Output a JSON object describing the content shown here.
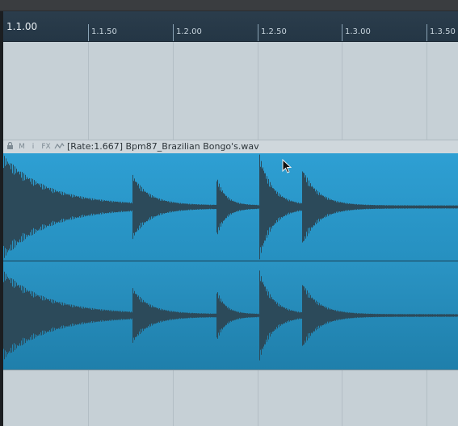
{
  "ruler": {
    "main_label": "1.1.00",
    "ticks": [
      "1.1.50",
      "1.2.00",
      "1.2.50",
      "1.3.00",
      "1.3.50"
    ]
  },
  "clip": {
    "title": "[Rate:1.667] Bpm87_Brazilian Bongo's.wav",
    "header_icons": {
      "lock": "lock-icon",
      "mute": "M",
      "info": "i",
      "fx": "FX",
      "envelope": "envelope-icon"
    },
    "colors": {
      "clip_fill": "#2b9bd0",
      "waveform": "#2c4a5a"
    }
  }
}
